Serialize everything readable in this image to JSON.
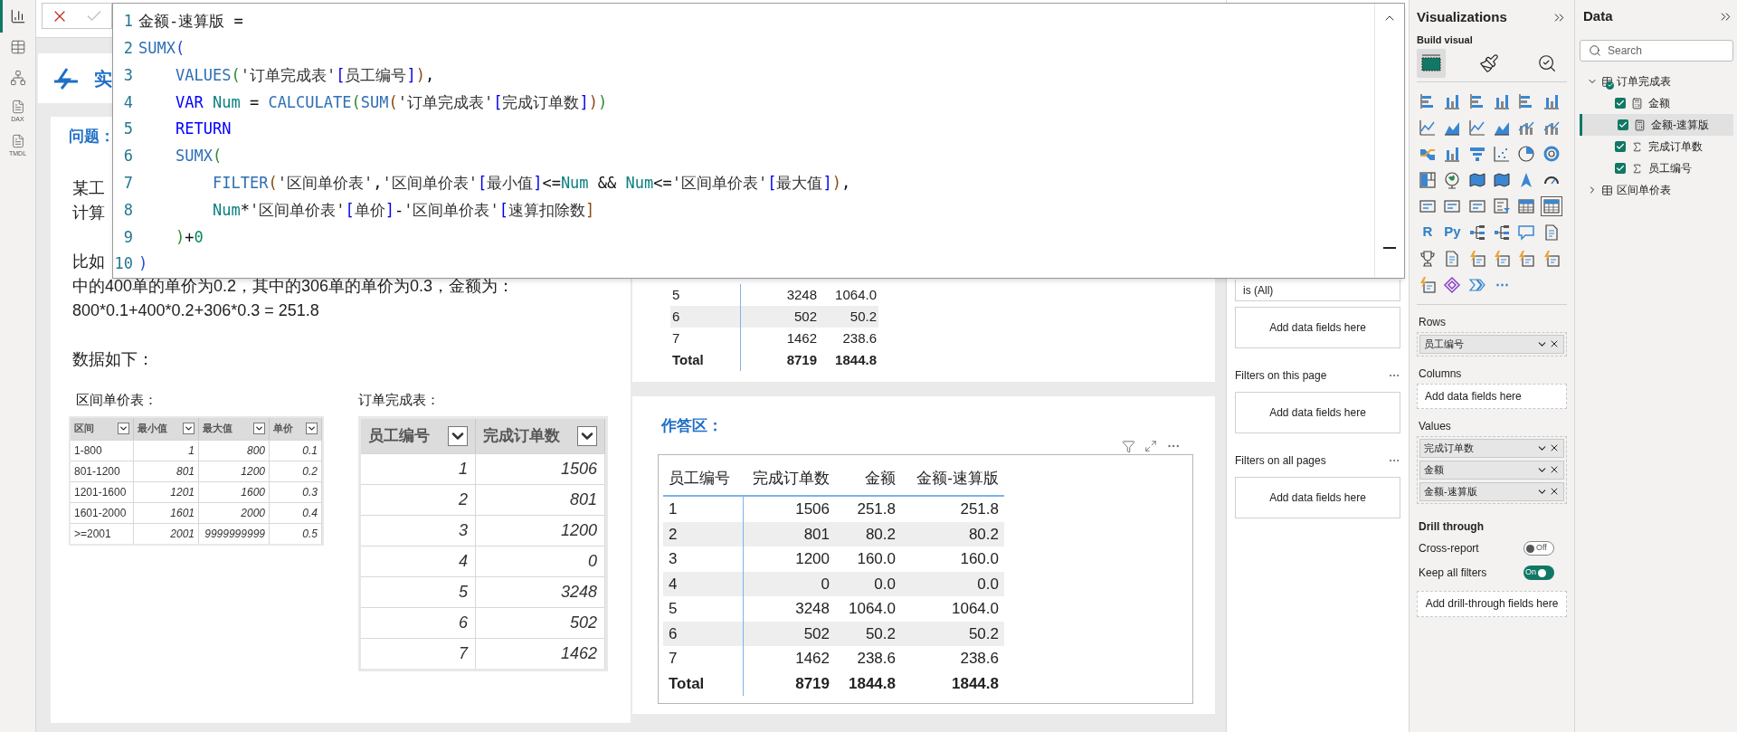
{
  "rail": [
    {
      "selected": true
    },
    {
      "selected": false
    },
    {
      "selected": false
    },
    {
      "selected": false,
      "label": "DAX"
    },
    {
      "selected": false,
      "label": "TMDL"
    }
  ],
  "editor": {
    "lines": [
      {
        "number": "1",
        "tokens": [
          {
            "text": "金额-速算版 ",
            "kind": "plain"
          },
          {
            "text": "=",
            "kind": "op"
          }
        ]
      },
      {
        "number": "2",
        "tokens": [
          {
            "text": "SUMX",
            "kind": "fn"
          },
          {
            "text": "(",
            "kind": "p3"
          }
        ]
      },
      {
        "number": "3",
        "kind": "inner",
        "tokens": [
          {
            "text": "VALUES",
            "kind": "fn"
          },
          {
            "text": "(",
            "kind": "p2"
          },
          {
            "text": "'订单完成表'",
            "kind": "str"
          },
          {
            "text": "[",
            "kind": "br"
          },
          {
            "text": "员工编号",
            "kind": "str"
          },
          {
            "text": "]",
            "kind": "br"
          },
          {
            "text": ")",
            "kind": "p1"
          },
          {
            "text": ",",
            "kind": "op"
          }
        ]
      },
      {
        "number": "4",
        "kind": "inner",
        "tokens": [
          {
            "text": "VAR ",
            "kind": "kw"
          },
          {
            "text": "Num",
            "kind": "var"
          },
          {
            "text": " = ",
            "kind": "op"
          },
          {
            "text": "CALCULATE",
            "kind": "fn"
          },
          {
            "text": "(",
            "kind": "p2"
          },
          {
            "text": "SUM",
            "kind": "fn"
          },
          {
            "text": "(",
            "kind": "p1"
          },
          {
            "text": "'订单完成表'",
            "kind": "str"
          },
          {
            "text": "[",
            "kind": "br"
          },
          {
            "text": "完成订单数",
            "kind": "str"
          },
          {
            "text": "]",
            "kind": "br"
          },
          {
            "text": ")",
            "kind": "p1"
          },
          {
            "text": ")",
            "kind": "p2"
          }
        ]
      },
      {
        "number": "5",
        "kind": "inner",
        "tokens": [
          {
            "text": "RETURN",
            "kind": "kw"
          }
        ]
      },
      {
        "number": "6",
        "kind": "inner",
        "tokens": [
          {
            "text": "SUMX",
            "kind": "fn"
          },
          {
            "text": "(",
            "kind": "p2"
          }
        ]
      },
      {
        "number": "7",
        "kind": "deep",
        "tokens": [
          {
            "text": "FILTER",
            "kind": "fn"
          },
          {
            "text": "(",
            "kind": "p1"
          },
          {
            "text": "'区间单价表'",
            "kind": "str"
          },
          {
            "text": ",",
            "kind": "op"
          },
          {
            "text": "'区间单价表'",
            "kind": "str"
          },
          {
            "text": "[",
            "kind": "br"
          },
          {
            "text": "最小值",
            "kind": "str"
          },
          {
            "text": "]",
            "kind": "br"
          },
          {
            "text": "<=",
            "kind": "op"
          },
          {
            "text": "Num",
            "kind": "var"
          },
          {
            "text": " && ",
            "kind": "op"
          },
          {
            "text": "Num",
            "kind": "var"
          },
          {
            "text": "<=",
            "kind": "op"
          },
          {
            "text": "'区间单价表'",
            "kind": "str"
          },
          {
            "text": "[",
            "kind": "br"
          },
          {
            "text": "最大值",
            "kind": "str"
          },
          {
            "text": "]",
            "kind": "br"
          },
          {
            "text": ")",
            "kind": "p1"
          },
          {
            "text": ",",
            "kind": "op"
          }
        ]
      },
      {
        "number": "8",
        "kind": "deep",
        "tokens": [
          {
            "text": "Num",
            "kind": "var"
          },
          {
            "text": "*",
            "kind": "op"
          },
          {
            "text": "'区间单价表'",
            "kind": "str"
          },
          {
            "text": "[",
            "kind": "br"
          },
          {
            "text": "单价",
            "kind": "str"
          },
          {
            "text": "]",
            "kind": "br"
          },
          {
            "text": "-",
            "kind": "op"
          },
          {
            "text": "'区间单价表'",
            "kind": "str"
          },
          {
            "text": "[",
            "kind": "br"
          },
          {
            "text": "速算扣除数",
            "kind": "str"
          },
          {
            "text": "]",
            "kind": "p1"
          }
        ]
      },
      {
        "number": "9",
        "kind": "inner",
        "tokens": [
          {
            "text": ")",
            "kind": "p2"
          },
          {
            "text": "+",
            "kind": "op"
          },
          {
            "text": "0",
            "kind": "num"
          }
        ]
      },
      {
        "number": "10",
        "tokens": [
          {
            "text": ")",
            "kind": "p3"
          }
        ]
      }
    ]
  },
  "header": {
    "title": "实"
  },
  "problem": {
    "title": "问题：",
    "lines": [
      "某工",
      "计算"
    ],
    "example_lines": [
      "比如",
      "中的400单的单价为0.2，其中的306单的单价为0.3，金额为：",
      "800*0.1+400*0.2+306*0.3 = 251.8"
    ],
    "data_intro": "数据如下："
  },
  "price_table": {
    "title": "区间单价表：",
    "columns": [
      "区间",
      "最小值",
      "最大值",
      "单价"
    ],
    "rows": [
      [
        "1-800",
        "1",
        "800",
        "0.1"
      ],
      [
        "801-1200",
        "801",
        "1200",
        "0.2"
      ],
      [
        "1201-1600",
        "1201",
        "1600",
        "0.3"
      ],
      [
        "1601-2000",
        "1601",
        "2000",
        "0.4"
      ],
      [
        ">=2001",
        "2001",
        "9999999999",
        "0.5"
      ]
    ]
  },
  "orders_table": {
    "title": "订单完成表：",
    "columns": [
      "员工编号",
      "完成订单数"
    ],
    "rows": [
      [
        "1",
        "1506"
      ],
      [
        "2",
        "801"
      ],
      [
        "3",
        "1200"
      ],
      [
        "4",
        "0"
      ],
      [
        "5",
        "3248"
      ],
      [
        "6",
        "502"
      ],
      [
        "7",
        "1462"
      ]
    ]
  },
  "top_visual": {
    "rows": [
      [
        "5",
        "3248",
        "1064.0"
      ],
      [
        "6",
        "502",
        "50.2"
      ],
      [
        "7",
        "1462",
        "238.6"
      ]
    ],
    "total": [
      "Total",
      "8719",
      "1844.8"
    ]
  },
  "answer": {
    "title": "作答区：",
    "columns": [
      "员工编号",
      "完成订单数",
      "金额",
      "金额-速算版"
    ],
    "rows": [
      [
        "1",
        "1506",
        "251.8",
        "251.8"
      ],
      [
        "2",
        "801",
        "80.2",
        "80.2"
      ],
      [
        "3",
        "1200",
        "160.0",
        "160.0"
      ],
      [
        "4",
        "0",
        "0.0",
        "0.0"
      ],
      [
        "5",
        "3248",
        "1064.0",
        "1064.0"
      ],
      [
        "6",
        "502",
        "50.2",
        "50.2"
      ],
      [
        "7",
        "1462",
        "238.6",
        "238.6"
      ]
    ],
    "total": [
      "Total",
      "8719",
      "1844.8",
      "1844.8"
    ]
  },
  "filters": {
    "field_value": "is (All)",
    "add_label": "Add data fields here",
    "sections": [
      {
        "title": "Filters on this page",
        "add_label": "Add data fields here"
      },
      {
        "title": "Filters on all pages",
        "add_label": "Add data fields here"
      }
    ]
  },
  "visualizations": {
    "title": "Visualizations",
    "subtitle": "Build visual",
    "build_tabs": [
      {
        "selected": true
      },
      {
        "selected": false
      },
      {
        "selected": false
      }
    ],
    "gallery": [
      {
        "selected": false
      },
      {
        "selected": false
      },
      {
        "selected": false
      },
      {
        "selected": false
      },
      {
        "selected": false
      },
      {
        "selected": false
      },
      {
        "selected": false
      },
      {
        "selected": false
      },
      {
        "selected": false
      },
      {
        "selected": false
      },
      {
        "selected": false
      },
      {
        "selected": false
      },
      {
        "selected": false
      },
      {
        "selected": false
      },
      {
        "selected": false
      },
      {
        "selected": false
      },
      {
        "selected": false
      },
      {
        "selected": false
      },
      {
        "selected": false
      },
      {
        "selected": false
      },
      {
        "selected": false
      },
      {
        "selected": false
      },
      {
        "selected": false
      },
      {
        "selected": false
      },
      {
        "selected": false
      },
      {
        "selected": false
      },
      {
        "selected": false
      },
      {
        "selected": false
      },
      {
        "selected": false
      },
      {
        "selected": true
      },
      {
        "label": "R",
        "selected": false
      },
      {
        "label": "Py",
        "selected": false
      },
      {
        "selected": false
      },
      {
        "selected": false
      },
      {
        "selected": false
      },
      {
        "selected": false
      },
      {
        "selected": false
      },
      {
        "selected": false
      },
      {
        "selected": false
      },
      {
        "selected": false
      },
      {
        "selected": false
      },
      {
        "selected": false
      },
      {
        "selected": false
      },
      {
        "selected": false
      },
      {
        "selected": false
      },
      {
        "label": "⋯",
        "selected": false
      }
    ],
    "wells": [
      {
        "title": "Rows",
        "fields": [
          "员工编号"
        ]
      },
      {
        "title": "Columns",
        "placeholder": "Add data fields here"
      },
      {
        "title": "Values",
        "fields": [
          "完成订单数",
          "金额",
          "金额-速算版"
        ]
      }
    ],
    "drill": {
      "title": "Drill through",
      "toggles": [
        {
          "label": "Cross-report",
          "on": false,
          "state_text": "Off"
        },
        {
          "label": "Keep all filters",
          "on": true,
          "state_text": "On"
        }
      ],
      "placeholder": "Add drill-through fields here"
    }
  },
  "data": {
    "title": "Data",
    "search_placeholder": "Search",
    "tables": [
      {
        "name": "订单完成表",
        "expanded": true,
        "checked": true,
        "children": [
          {
            "name": "金额",
            "kind": "measure",
            "checked": true,
            "selected": false
          },
          {
            "name": "金额-速算版",
            "kind": "measure",
            "checked": true,
            "selected": true
          },
          {
            "name": "完成订单数",
            "kind": "sum",
            "checked": true,
            "selected": false
          },
          {
            "name": "员工编号",
            "kind": "sum",
            "checked": true,
            "selected": false
          }
        ]
      },
      {
        "name": "区间单价表",
        "expanded": false,
        "checked": false
      }
    ]
  }
}
